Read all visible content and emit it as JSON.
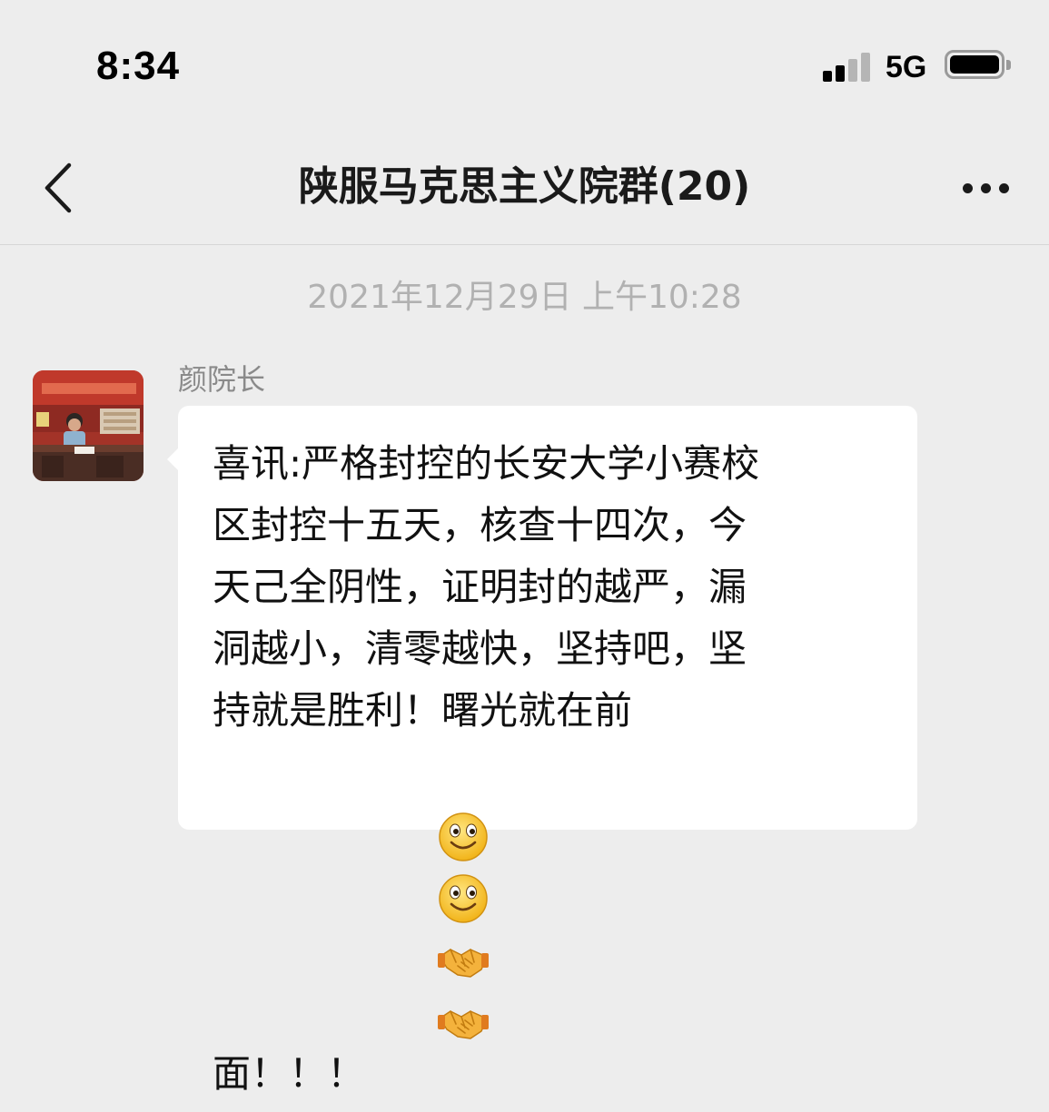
{
  "status_bar": {
    "time": "8:34",
    "network": "5G",
    "icons": [
      "cellular-signal-icon",
      "battery-icon"
    ]
  },
  "nav": {
    "back_icon": "chevron-left-icon",
    "title": "陕服马克思主义院群(20)",
    "more_icon": "more-dots-icon"
  },
  "chat": {
    "timestamp": "2021年12月29日 上午10:28",
    "message": {
      "sender": "颜院长",
      "avatar_icon": "avatar-photo",
      "text": "喜讯:严格封控的长安大学小赛校\n区封控十五天，核查十四次，今\n天己全阴性，证明封的越严，漏\n洞越小，清零越快，坚持吧，坚\n持就是胜利！曙光就在前\n面！！！",
      "emojis": [
        "smiley-emoji",
        "smiley-emoji",
        "handshake-emoji",
        "handshake-emoji"
      ]
    }
  },
  "colors": {
    "background": "#ededed",
    "bubble": "#ffffff",
    "timestamp": "#b1b1b1",
    "sender_name": "#8a8a8a"
  }
}
